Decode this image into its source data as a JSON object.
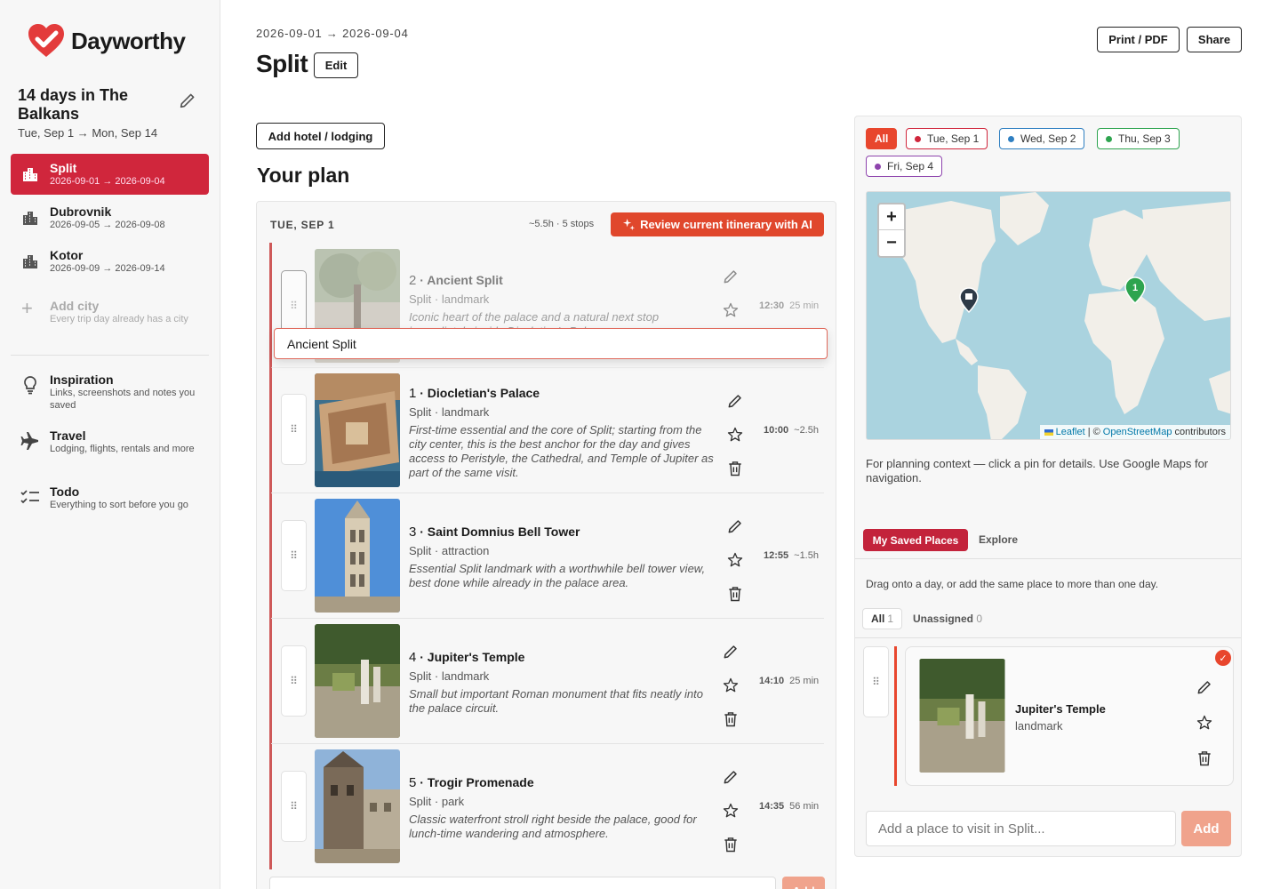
{
  "app": {
    "name": "Dayworthy"
  },
  "trip": {
    "title": "14 days in The Balkans",
    "dates": "Tue, Sep 1 → Mon, Sep 14"
  },
  "cities": [
    {
      "name": "Split",
      "dates": "2026-09-01 → 2026-09-04",
      "active": true
    },
    {
      "name": "Dubrovnik",
      "dates": "2026-09-05 → 2026-09-08"
    },
    {
      "name": "Kotor",
      "dates": "2026-09-09 → 2026-09-14"
    }
  ],
  "add_city": {
    "label": "Add city",
    "sub": "Every trip day already has a city"
  },
  "nav": [
    {
      "name": "Inspiration",
      "sub": "Links, screenshots and notes you saved",
      "icon": "lightbulb-icon"
    },
    {
      "name": "Travel",
      "sub": "Lodging, flights, rentals and more",
      "icon": "plane-icon"
    },
    {
      "name": "Todo",
      "sub": "Everything to sort before you go",
      "icon": "checklist-icon"
    }
  ],
  "header": {
    "date_range": "2026-09-01 → 2026-09-04",
    "city": "Split",
    "edit_label": "Edit",
    "print_label": "Print / PDF",
    "share_label": "Share",
    "hotel_label": "Add hotel / lodging",
    "plan_title": "Your plan"
  },
  "day": {
    "label": "TUE, SEP 1",
    "meta": "~5.5h · 5 stops",
    "ai_label": "Review current itinerary with AI",
    "add_label": "Add"
  },
  "drag_preview": "Ancient Split",
  "stops": [
    {
      "num": "2",
      "name": "Ancient Split",
      "category": "Split · landmark",
      "desc": "Iconic heart of the palace and a natural next stop immediately inside Diocletian's Palace",
      "time": "12:30",
      "duration": "25 min",
      "ghost": true
    },
    {
      "num": "1",
      "name": "Diocletian's Palace",
      "category": "Split · landmark",
      "desc": "First-time essential and the core of Split; starting from the city center, this is the best anchor for the day and gives access to Peristyle, the Cathedral, and Temple of Jupiter as part of the same visit.",
      "time": "10:00",
      "duration": "~2.5h"
    },
    {
      "num": "3",
      "name": "Saint Domnius Bell Tower",
      "category": "Split · attraction",
      "desc": "Essential Split landmark with a worthwhile bell tower view, best done while already in the palace area.",
      "time": "12:55",
      "duration": "~1.5h"
    },
    {
      "num": "4",
      "name": "Jupiter's Temple",
      "category": "Split · landmark",
      "desc": "Small but important Roman monument that fits neatly into the palace circuit.",
      "time": "14:10",
      "duration": "25 min"
    },
    {
      "num": "5",
      "name": "Trogir Promenade",
      "category": "Split · park",
      "desc": "Classic waterfront stroll right beside the palace, good for lunch-time wandering and atmosphere.",
      "time": "14:35",
      "duration": "56 min"
    }
  ],
  "day_chips": [
    {
      "label": "All",
      "active": true
    },
    {
      "label": "Tue, Sep 1",
      "color": "#d0263c"
    },
    {
      "label": "Wed, Sep 2",
      "color": "#2f7fc1"
    },
    {
      "label": "Thu, Sep 3",
      "color": "#2ea44f"
    },
    {
      "label": "Fri, Sep 4",
      "color": "#8e44ad"
    }
  ],
  "map": {
    "attribution_leaflet": "Leaflet",
    "attribution_sep": "| ©",
    "attribution_osm": "OpenStreetMap",
    "attribution_tail": "contributors",
    "pin_label": "1",
    "note": "For planning context — click a pin for details. Use Google Maps for navigation."
  },
  "saved": {
    "tab_saved": "My Saved Places",
    "tab_explore": "Explore",
    "drag_note": "Drag onto a day, or add the same place to more than one day.",
    "filter_all": "All",
    "filter_all_count": "1",
    "filter_unassigned": "Unassigned",
    "filter_unassigned_count": "0",
    "place_name": "Jupiter's Temple",
    "place_category": "landmark",
    "input_placeholder": "Add a place to visit in Split...",
    "add_label": "Add"
  },
  "colors": {
    "accent": "#d0263c",
    "ai": "#e0472c",
    "chip_all": "#e8462d"
  }
}
